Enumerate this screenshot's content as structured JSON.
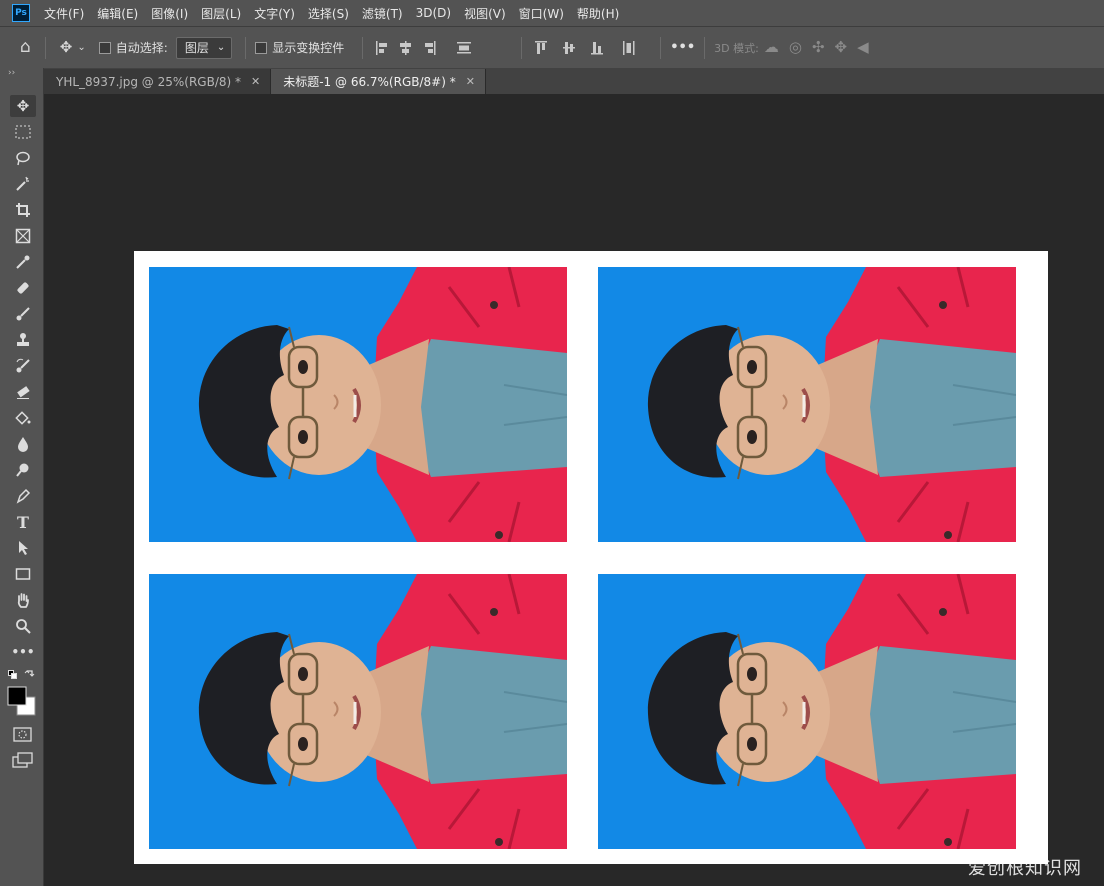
{
  "app": {
    "logo": "Ps"
  },
  "menu": [
    "文件(F)",
    "编辑(E)",
    "图像(I)",
    "图层(L)",
    "文字(Y)",
    "选择(S)",
    "滤镜(T)",
    "3D(D)",
    "视图(V)",
    "窗口(W)",
    "帮助(H)"
  ],
  "options": {
    "auto_select_label": "自动选择:",
    "auto_select_value": "图层",
    "show_transform_label": "显示变换控件",
    "more": "•••",
    "mode_3d_label": "3D 模式:"
  },
  "tabs": [
    {
      "label": "YHL_8937.jpg @ 25%(RGB/8) *",
      "active": false
    },
    {
      "label": "未标题-1 @ 66.7%(RGB/8#) *",
      "active": true
    }
  ],
  "tools": [
    "move-tool",
    "marquee-tool",
    "lasso-tool",
    "magic-wand-tool",
    "crop-tool",
    "frame-tool",
    "eyedropper-tool",
    "healing-brush-tool",
    "brush-tool",
    "clone-stamp-tool",
    "history-brush-tool",
    "eraser-tool",
    "paint-bucket-tool",
    "blur-tool",
    "dodge-tool",
    "pen-tool",
    "type-tool",
    "path-selection-tool",
    "rectangle-tool",
    "hand-tool",
    "zoom-tool",
    "more-tools"
  ],
  "tool_labels": {
    "type": "T",
    "more": "•••"
  },
  "colors": {
    "foreground": "#000000",
    "background": "#ffffff",
    "photo_bg": "#1289e6",
    "jacket": "#e8254d",
    "shirt": "#6a9cae"
  },
  "watermark": "爱创根知识网"
}
